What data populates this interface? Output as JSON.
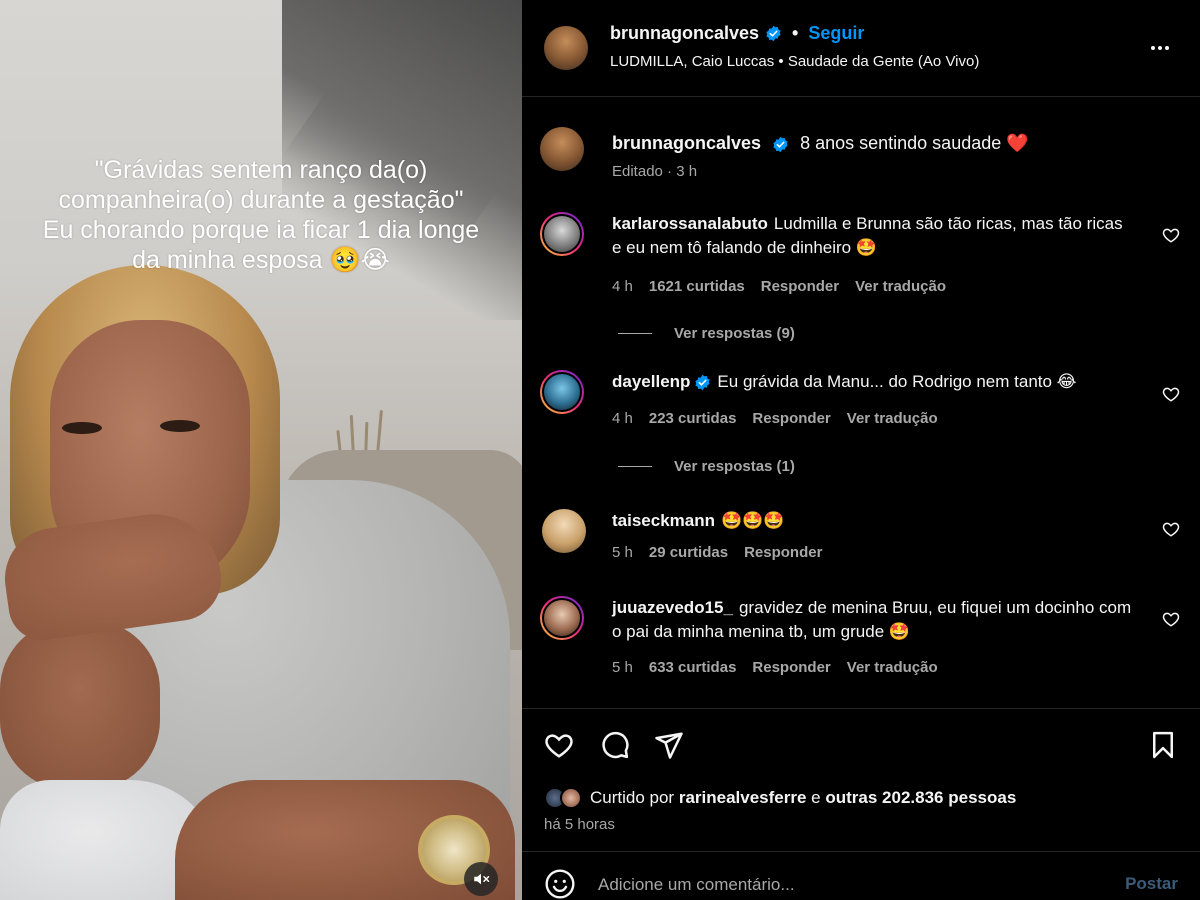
{
  "media": {
    "overlay_lines": [
      "\"Grávidas sentem ranço da(o)",
      "companheira(o) durante a gestação\"",
      "Eu chorando porque ia ficar 1 dia longe",
      "da minha esposa 🥹😭"
    ]
  },
  "post": {
    "username": "brunnagoncalves",
    "follow_label": "Seguir",
    "separator": "•",
    "music": "LUDMILLA, Caio Luccas • Saudade da Gente (Ao Vivo)",
    "caption_text": "8 anos sentindo saudade ❤️",
    "caption_meta": "Editado · 3 h"
  },
  "comments": [
    {
      "username": "karlarossanalabuto",
      "text": "Ludmilla e Brunna são tão ricas, mas tão ricas e eu nem tô falando de dinheiro 🤩",
      "time": "4 h",
      "likes": "1621 curtidas",
      "reply": "Responder",
      "translate": "Ver tradução",
      "replies_label": "Ver respostas (9)"
    },
    {
      "username": "dayellenp",
      "text": "Eu grávida da Manu... do Rodrigo nem tanto 😂",
      "time": "4 h",
      "likes": "223 curtidas",
      "reply": "Responder",
      "translate": "Ver tradução",
      "replies_label": "Ver respostas (1)"
    },
    {
      "username": "taiseckmann",
      "text": "🤩🤩🤩",
      "time": "5 h",
      "likes": "29 curtidas",
      "reply": "Responder"
    },
    {
      "username": "juuazevedo15_",
      "text": "gravidez de menina Bruu, eu fiquei um docinho com o pai da minha menina tb, um grude 🤩",
      "time": "5 h",
      "likes": "633 curtidas",
      "reply": "Responder",
      "translate": "Ver tradução"
    }
  ],
  "footer": {
    "liked_prefix": "Curtido por",
    "liked_user": "rarinealvesferre",
    "liked_and": "e",
    "liked_others": "outras 202.836 pessoas",
    "time_ago": "há 5 horas",
    "comment_placeholder": "Adicione um comentário...",
    "post_label": "Postar"
  },
  "colors": {
    "background": "#000000",
    "text": "#f5f5f5",
    "secondary": "#a8a8a8",
    "link_blue": "#0095f6",
    "divider": "#262626",
    "heart_red": "#ff3040"
  }
}
